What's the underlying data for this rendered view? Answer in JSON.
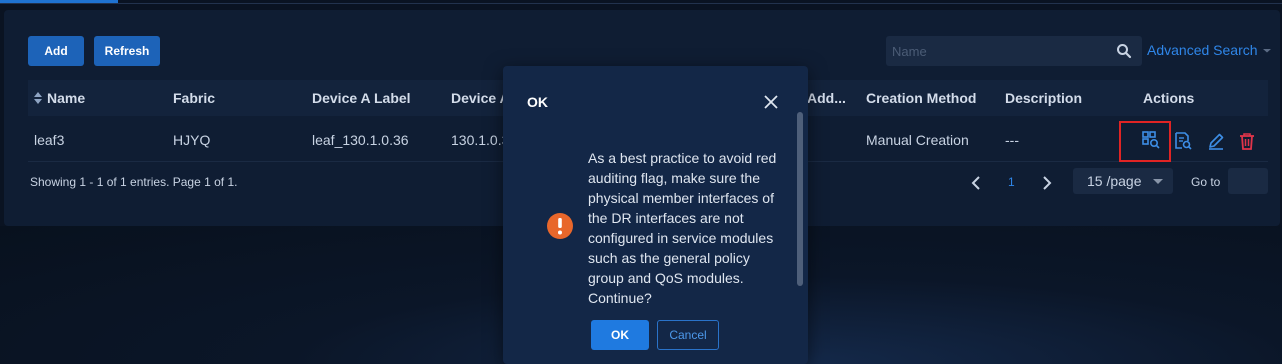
{
  "toolbar": {
    "add_label": "Add",
    "refresh_label": "Refresh"
  },
  "search": {
    "placeholder": "Name",
    "advanced_label": "Advanced Search"
  },
  "table": {
    "columns": [
      "Name",
      "Fabric",
      "Device A Label",
      "Device A",
      "Add...",
      "Creation Method",
      "Description",
      "Actions"
    ],
    "rows": [
      {
        "name": "leaf3",
        "fabric": "HJYQ",
        "device_a_label": "leaf_130.1.0.36",
        "device_a": "130.1.0.3",
        "creation_method": "Manual Creation",
        "description": "---"
      }
    ],
    "action_icons": [
      "member-interfaces-icon",
      "view-details-icon",
      "edit-icon",
      "delete-icon"
    ]
  },
  "pagination": {
    "summary": "Showing 1 - 1 of 1 entries. Page 1 of 1.",
    "current_page": "1",
    "page_size": "15 /page",
    "goto_label": "Go to"
  },
  "dialog": {
    "title": "OK",
    "message": "As a best practice to avoid red auditing flag, make sure the physical member interfaces of the DR interfaces are not configured in service modules such as the general policy group and QoS modules. Continue?",
    "ok_label": "OK",
    "cancel_label": "Cancel"
  },
  "colors": {
    "accent": "#1f7ae0",
    "warning": "#e8672b",
    "danger": "#e02424"
  }
}
